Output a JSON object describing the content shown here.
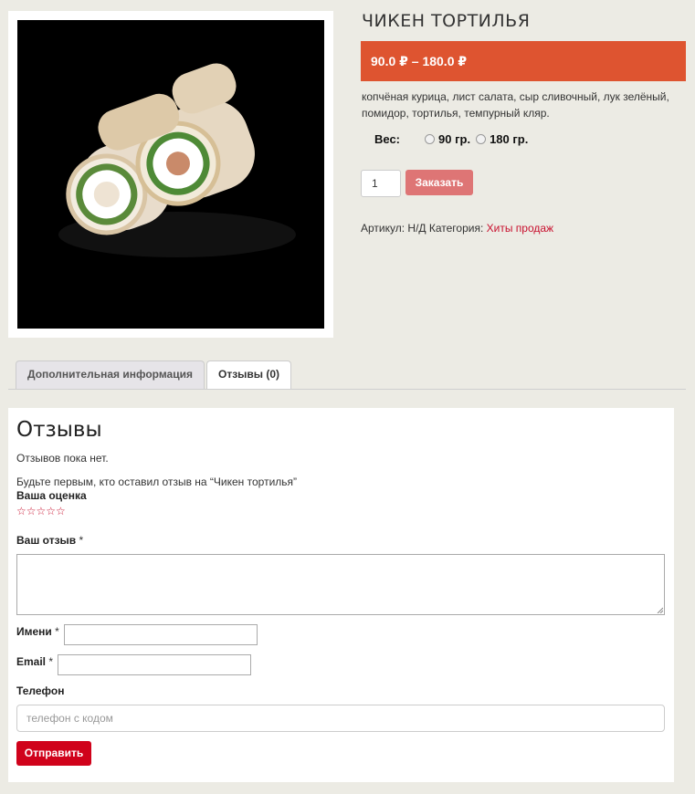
{
  "product": {
    "title": "ЧИКЕН ТОРТИЛЬЯ",
    "price": "90.0 ₽ – 180.0 ₽",
    "description": "копчёная курица, лист салата, сыр сливочный, лук зелёный, помидор, тортилья, темпурный кляр.",
    "weight_label": "Вес:",
    "weight_options": [
      "90 гр.",
      "180 гр."
    ],
    "quantity": "1",
    "order_button": "Заказать",
    "sku_text": "Артикул: Н/Д Категория:",
    "category_link": "Хиты продаж",
    "image_icon": "food-photo"
  },
  "tabs": [
    {
      "label": "Дополнительная информация"
    },
    {
      "label": "Отзывы (0)"
    }
  ],
  "reviews": {
    "heading": "Отзывы",
    "no_reviews": "Отзывов пока нет.",
    "be_first": "Будьте первым, кто оставил отзыв на “Чикен тортилья”",
    "rating_label": "Ваша оценка",
    "stars": "☆☆☆☆☆",
    "review_label": "Ваш отзыв",
    "name_label": "Имени",
    "email_label": "Email",
    "required_mark": "*",
    "phone_label": "Телефон",
    "phone_placeholder": "телефон с кодом",
    "submit": "Отправить"
  },
  "colors": {
    "price_bar": "#de5430",
    "order_button": "#de7575",
    "submit_button": "#d0021b",
    "link": "#c8102e"
  }
}
